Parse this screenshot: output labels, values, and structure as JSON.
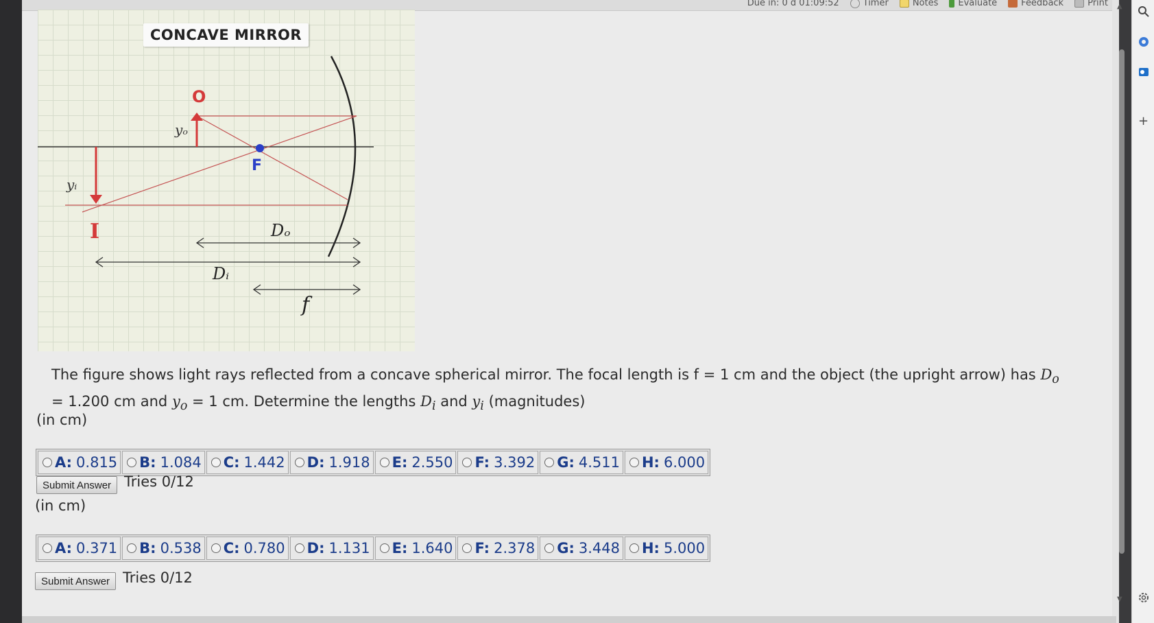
{
  "topbar": {
    "due": "Due in: 0 d 01:09:52",
    "timer": "Timer",
    "notes": "Notes",
    "evaluate": "Evaluate",
    "feedback": "Feedback",
    "print": "Print"
  },
  "figure": {
    "title": "CONCAVE MIRROR",
    "labels": {
      "object": "O",
      "yo": "yₒ",
      "focus": "F",
      "yi": "yᵢ",
      "image": "I",
      "do": "Dₒ",
      "di": "Dᵢ",
      "f": "f"
    }
  },
  "question": {
    "p1": "The figure shows light rays reflected from a concave spherical mirror. The focal length is f = 1 cm and the object (the upright arrow) has ",
    "do_sym": "D",
    "do_sub": "o",
    "p2": " = 1.200 cm and ",
    "yo_sym": "y",
    "yo_sub": "o",
    "p3": " = 1 cm. Determine the lengths ",
    "di_sym": "D",
    "di_sub": "i",
    "p4": " and ",
    "yi_sym": "y",
    "yi_sub": "i",
    "p5": " (magnitudes)"
  },
  "parts": [
    {
      "unit": "(in cm)",
      "choices": [
        {
          "letter": "A:",
          "value": "0.815"
        },
        {
          "letter": "B:",
          "value": "1.084"
        },
        {
          "letter": "C:",
          "value": "1.442"
        },
        {
          "letter": "D:",
          "value": "1.918"
        },
        {
          "letter": "E:",
          "value": "2.550"
        },
        {
          "letter": "F:",
          "value": "3.392"
        },
        {
          "letter": "G:",
          "value": "4.511"
        },
        {
          "letter": "H:",
          "value": "6.000"
        }
      ],
      "submit": "Submit Answer",
      "tries": "Tries 0/12"
    },
    {
      "unit": "(in cm)",
      "choices": [
        {
          "letter": "A:",
          "value": "0.371"
        },
        {
          "letter": "B:",
          "value": "0.538"
        },
        {
          "letter": "C:",
          "value": "0.780"
        },
        {
          "letter": "D:",
          "value": "1.131"
        },
        {
          "letter": "E:",
          "value": "1.640"
        },
        {
          "letter": "F:",
          "value": "2.378"
        },
        {
          "letter": "G:",
          "value": "3.448"
        },
        {
          "letter": "H:",
          "value": "5.000"
        }
      ],
      "submit": "Submit Answer",
      "tries": "Tries 0/12"
    }
  ],
  "rail": {
    "icons": [
      "search-icon",
      "copilot-icon",
      "outlook-icon",
      "add-icon",
      "settings-icon"
    ],
    "plus": "+"
  },
  "colors": {
    "accent": "#1b3c8a",
    "diagram_red": "#d43a3a",
    "diagram_blue": "#2b3fc8"
  }
}
